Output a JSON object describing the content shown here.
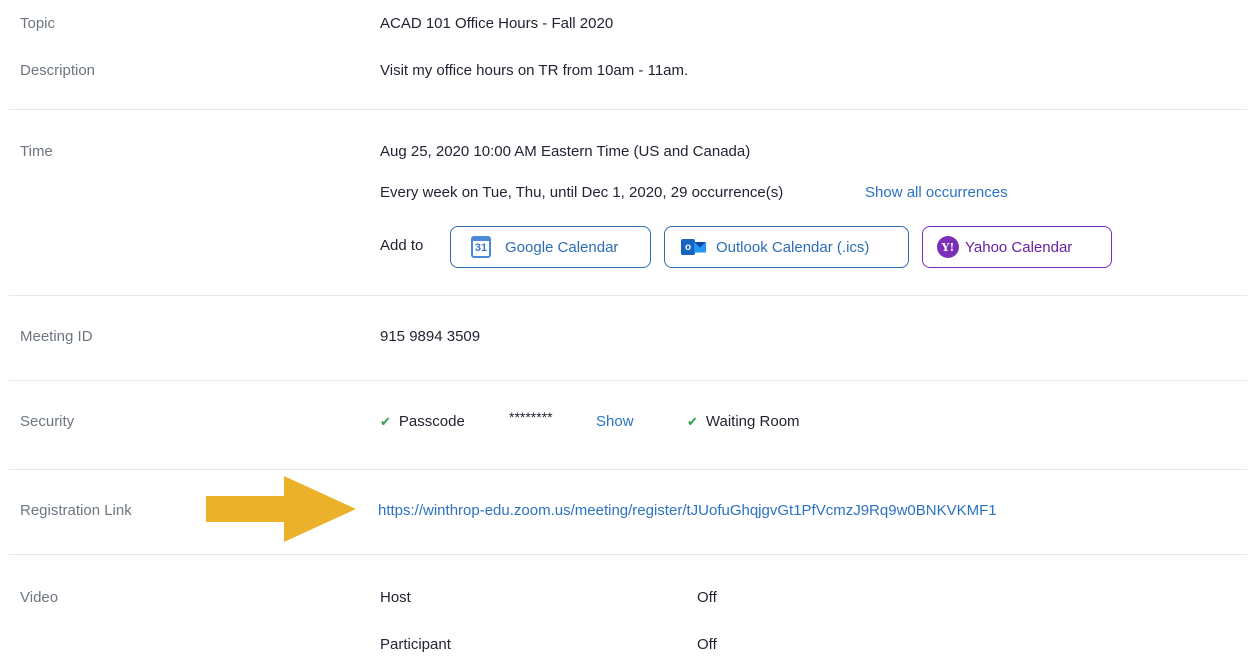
{
  "topic": {
    "label": "Topic",
    "value": "ACAD 101 Office Hours - Fall 2020"
  },
  "description": {
    "label": "Description",
    "value": "Visit my office hours on TR from 10am - 11am."
  },
  "time": {
    "label": "Time",
    "datetime": "Aug 25, 2020 10:00 AM Eastern Time (US and Canada)",
    "recurrence": "Every week on Tue, Thu, until Dec 1, 2020, 29 occurrence(s)",
    "show_all_label": "Show all occurrences",
    "add_to_label": "Add to",
    "google_label": "Google Calendar",
    "google_icon_text": "31",
    "outlook_label": "Outlook Calendar (.ics)",
    "outlook_icon_text": "o",
    "yahoo_label": "Yahoo Calendar",
    "yahoo_icon_text": "Y!"
  },
  "meeting_id": {
    "label": "Meeting ID",
    "value": "915 9894 3509"
  },
  "security": {
    "label": "Security",
    "passcode_label": "Passcode",
    "passcode_mask": "********",
    "show_label": "Show",
    "waiting_room_label": "Waiting Room"
  },
  "registration": {
    "label": "Registration Link",
    "url": "https://winthrop-edu.zoom.us/meeting/register/tJUofuGhqjgvGt1PfVcmzJ9Rq9w0BNKVKMF1"
  },
  "video": {
    "label": "Video",
    "host_label": "Host",
    "host_value": "Off",
    "participant_label": "Participant",
    "participant_value": "Off"
  },
  "colors": {
    "link": "#2c72c3",
    "arrow": "#ebb12b",
    "check": "#2e9e4f",
    "yahoo": "#7b2fb6"
  }
}
